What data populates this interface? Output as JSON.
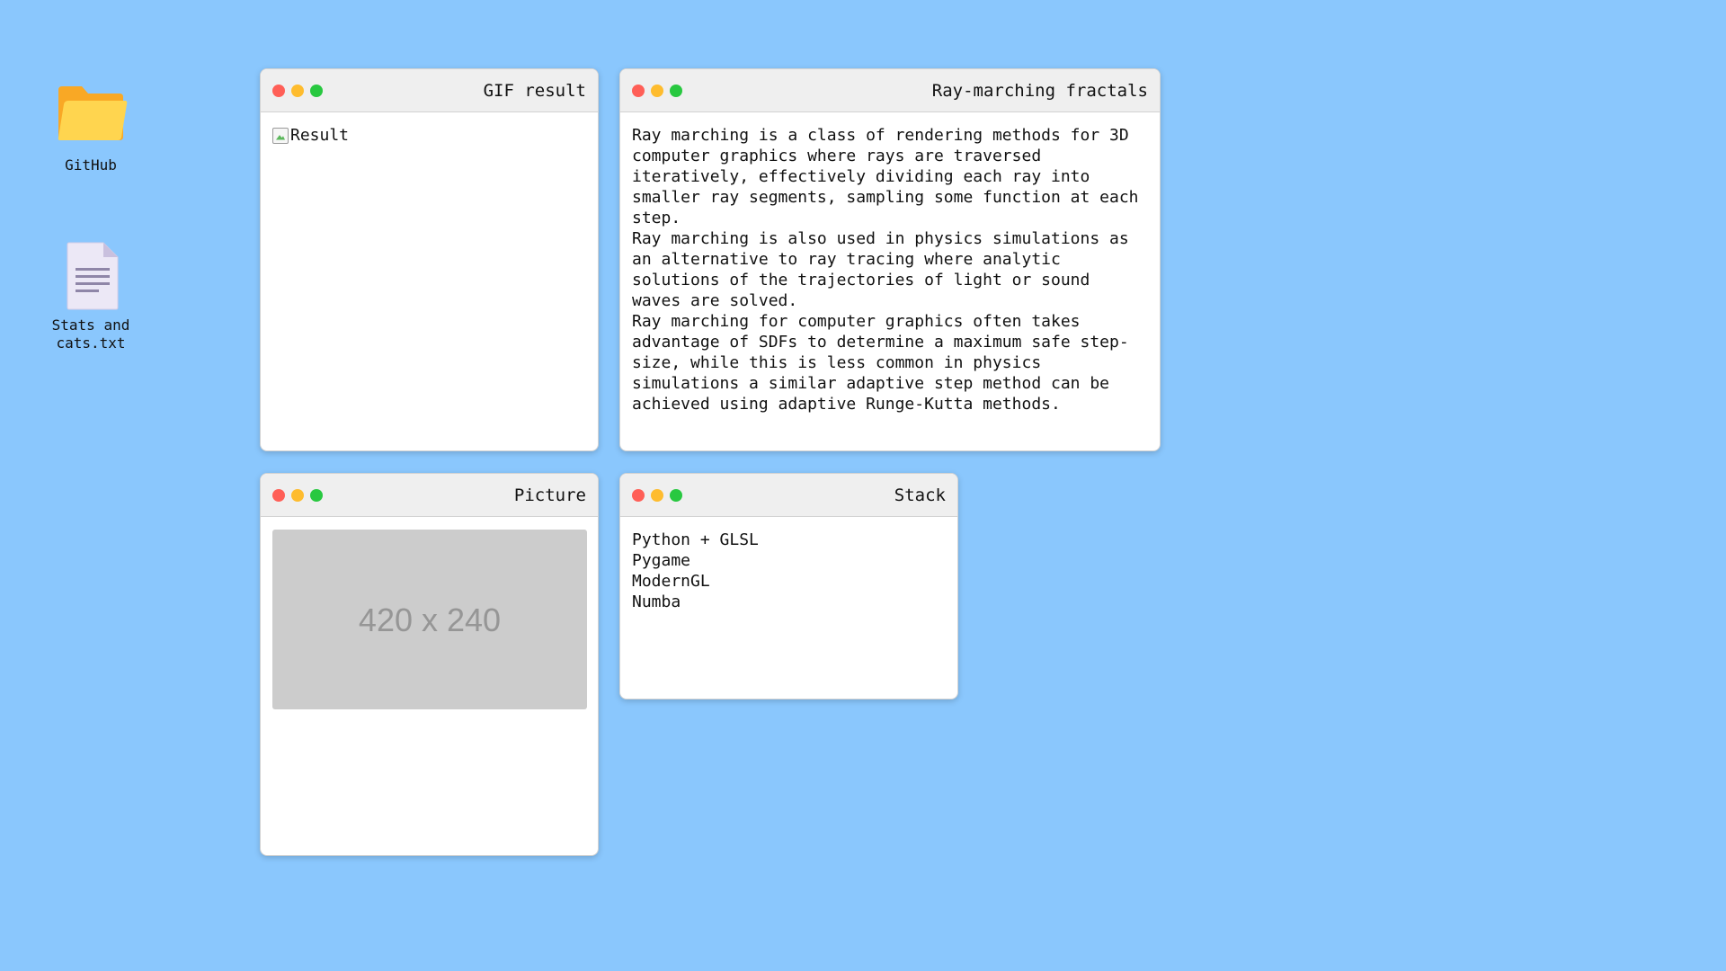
{
  "desktop": {
    "icons": [
      {
        "label": "GitHub",
        "icon": "folder-icon"
      },
      {
        "label": "Stats and\ncats.txt",
        "icon": "text-file-icon"
      }
    ]
  },
  "windows": {
    "gif": {
      "title": "GIF result",
      "image_alt": "Result"
    },
    "ray": {
      "title": "Ray-marching fractals",
      "paragraphs": [
        "Ray marching is a class of rendering methods for 3D computer graphics where rays are traversed iteratively, effectively dividing each ray into smaller ray segments, sampling some function at each step.",
        "Ray marching is also used in physics simulations as an alternative to ray tracing where analytic solutions of the trajectories of light or sound waves are solved.",
        "Ray marching for computer graphics often takes advantage of SDFs to determine a maximum safe step-size, while this is less common in physics simulations a similar adaptive step method can be achieved using adaptive Runge-Kutta methods."
      ]
    },
    "picture": {
      "title": "Picture",
      "placeholder_text": "420 x 240"
    },
    "stack": {
      "title": "Stack",
      "items": [
        "Python + GLSL",
        "Pygame",
        "ModernGL",
        "Numba"
      ]
    }
  },
  "colors": {
    "desktop_bg": "#8ac7fd",
    "close": "#ff5f57",
    "minimize": "#febc2e",
    "maximize": "#28c840"
  }
}
